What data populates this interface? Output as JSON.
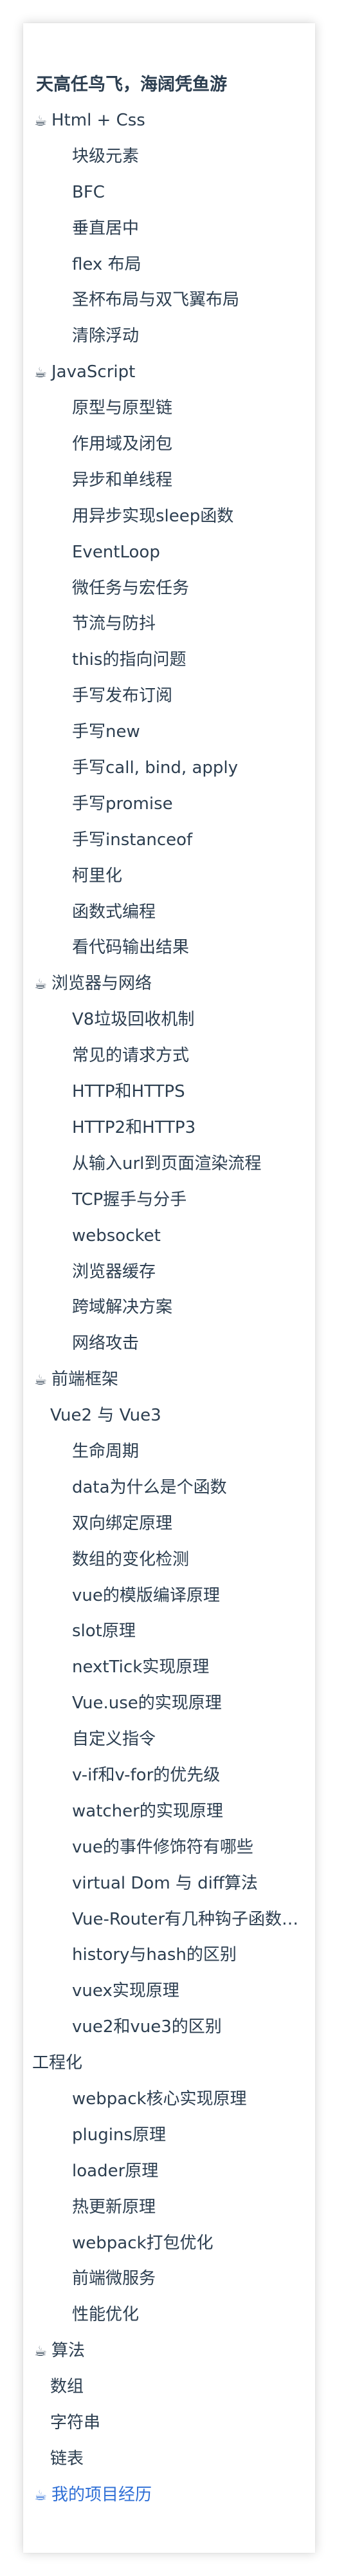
{
  "site_title": "天高任鸟飞，海阔凭鱼游",
  "icons": {
    "section": "coffee-cup-icon",
    "section_glyph": "☕"
  },
  "colors": {
    "text": "#2c3e50",
    "link": "#2f6fd6"
  },
  "nav": [
    {
      "label": "Html + Css",
      "level": 0,
      "icon": true
    },
    {
      "label": "块级元素",
      "level": 2
    },
    {
      "label": "BFC",
      "level": 2
    },
    {
      "label": "垂直居中",
      "level": 2
    },
    {
      "label": "flex 布局",
      "level": 2
    },
    {
      "label": "圣杯布局与双飞翼布局",
      "level": 2
    },
    {
      "label": "清除浮动",
      "level": 2
    },
    {
      "label": "JavaScript",
      "level": 0,
      "icon": true
    },
    {
      "label": "原型与原型链",
      "level": 2
    },
    {
      "label": "作用域及闭包",
      "level": 2
    },
    {
      "label": "异步和单线程",
      "level": 2
    },
    {
      "label": "用异步实现sleep函数",
      "level": 2
    },
    {
      "label": "EventLoop",
      "level": 2
    },
    {
      "label": "微任务与宏任务",
      "level": 2
    },
    {
      "label": "节流与防抖",
      "level": 2
    },
    {
      "label": "this的指向问题",
      "level": 2
    },
    {
      "label": "手写发布订阅",
      "level": 2
    },
    {
      "label": "手写new",
      "level": 2
    },
    {
      "label": "手写call, bind, apply",
      "level": 2
    },
    {
      "label": "手写promise",
      "level": 2
    },
    {
      "label": "手写instanceof",
      "level": 2
    },
    {
      "label": "柯里化",
      "level": 2
    },
    {
      "label": "函数式编程",
      "level": 2
    },
    {
      "label": "看代码输出结果",
      "level": 2
    },
    {
      "label": "浏览器与网络",
      "level": 0,
      "icon": true
    },
    {
      "label": "V8垃圾回收机制",
      "level": 2
    },
    {
      "label": "常见的请求方式",
      "level": 2
    },
    {
      "label": "HTTP和HTTPS",
      "level": 2
    },
    {
      "label": "HTTP2和HTTP3",
      "level": 2
    },
    {
      "label": "从输入url到页面渲染流程",
      "level": 2
    },
    {
      "label": "TCP握手与分手",
      "level": 2
    },
    {
      "label": "websocket",
      "level": 2
    },
    {
      "label": "浏览器缓存",
      "level": 2
    },
    {
      "label": "跨域解决方案",
      "level": 2
    },
    {
      "label": "网络攻击",
      "level": 2
    },
    {
      "label": "前端框架",
      "level": 0,
      "icon": true
    },
    {
      "label": "Vue2 与 Vue3",
      "level": 1
    },
    {
      "label": "生命周期",
      "level": 2
    },
    {
      "label": "data为什么是个函数",
      "level": 2
    },
    {
      "label": "双向绑定原理",
      "level": 2
    },
    {
      "label": "数组的变化检测",
      "level": 2
    },
    {
      "label": "vue的模版编译原理",
      "level": 2
    },
    {
      "label": "slot原理",
      "level": 2
    },
    {
      "label": "nextTick实现原理",
      "level": 2
    },
    {
      "label": "Vue.use的实现原理",
      "level": 2
    },
    {
      "label": "自定义指令",
      "level": 2
    },
    {
      "label": "v-if和v-for的优先级",
      "level": 2
    },
    {
      "label": "watcher的实现原理",
      "level": 2
    },
    {
      "label": "vue的事件修饰符有哪些",
      "level": 2
    },
    {
      "label": "virtual Dom 与 diff算法",
      "level": 2
    },
    {
      "label": "Vue-Router有几种钩子函数…",
      "level": 2
    },
    {
      "label": "history与hash的区别",
      "level": 2
    },
    {
      "label": "vuex实现原理",
      "level": 2
    },
    {
      "label": "vue2和vue3的区别",
      "level": 2
    },
    {
      "label": "工程化",
      "level": 0,
      "icon": false
    },
    {
      "label": "webpack核心实现原理",
      "level": 2
    },
    {
      "label": "plugins原理",
      "level": 2
    },
    {
      "label": "loader原理",
      "level": 2
    },
    {
      "label": "热更新原理",
      "level": 2
    },
    {
      "label": "webpack打包优化",
      "level": 2
    },
    {
      "label": "前端微服务",
      "level": 2
    },
    {
      "label": "性能优化",
      "level": 2
    },
    {
      "label": "算法",
      "level": 0,
      "icon": true
    },
    {
      "label": "数组",
      "level": 1
    },
    {
      "label": "字符串",
      "level": 1
    },
    {
      "label": "链表",
      "level": 1
    },
    {
      "label": "我的项目经历",
      "level": 0,
      "icon": true,
      "blue": true
    }
  ]
}
